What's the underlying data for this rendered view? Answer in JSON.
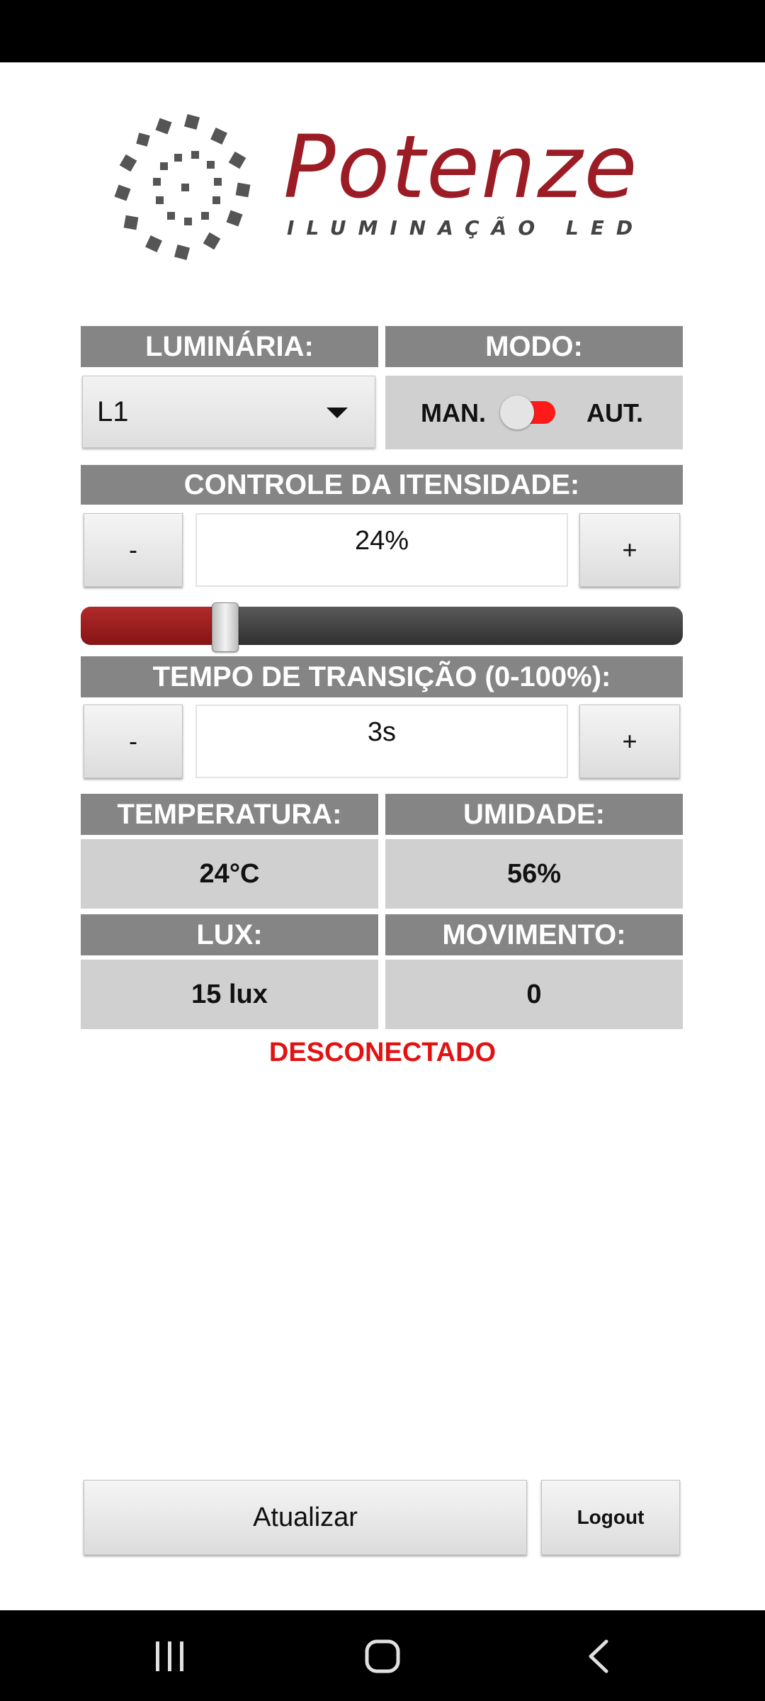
{
  "logo": {
    "brand": "Potenze",
    "tagline": "ILUMINAÇÃO LED"
  },
  "colors": {
    "header_bg": "#858585",
    "accent": "#9b1c24",
    "toggle": "#ff1a1a",
    "status": "#e31212"
  },
  "luminaria": {
    "label": "LUMINÁRIA:",
    "selected": "L1"
  },
  "modo": {
    "label": "MODO:",
    "left": "MAN.",
    "right": "AUT.",
    "state": "AUT."
  },
  "intensidade": {
    "label": "CONTROLE DA ITENSIDADE:",
    "minus": "-",
    "plus": "+",
    "value": "24%",
    "level": 0.24
  },
  "transicao": {
    "label": "TEMPO DE TRANSIÇÃO (0-100%):",
    "minus": "-",
    "plus": "+",
    "value": "3s"
  },
  "sensors": {
    "temperatura": {
      "label": "TEMPERATURA:",
      "value": "24°C"
    },
    "umidade": {
      "label": "UMIDADE:",
      "value": "56%"
    },
    "lux": {
      "label": "LUX:",
      "value": "15 lux"
    },
    "movimento": {
      "label": "MOVIMENTO:",
      "value": "0"
    }
  },
  "connection_status": "DESCONECTADO",
  "actions": {
    "refresh": "Atualizar",
    "logout": "Logout"
  },
  "system_nav": {
    "icons": [
      "recent-apps-icon",
      "home-icon",
      "back-icon"
    ]
  }
}
